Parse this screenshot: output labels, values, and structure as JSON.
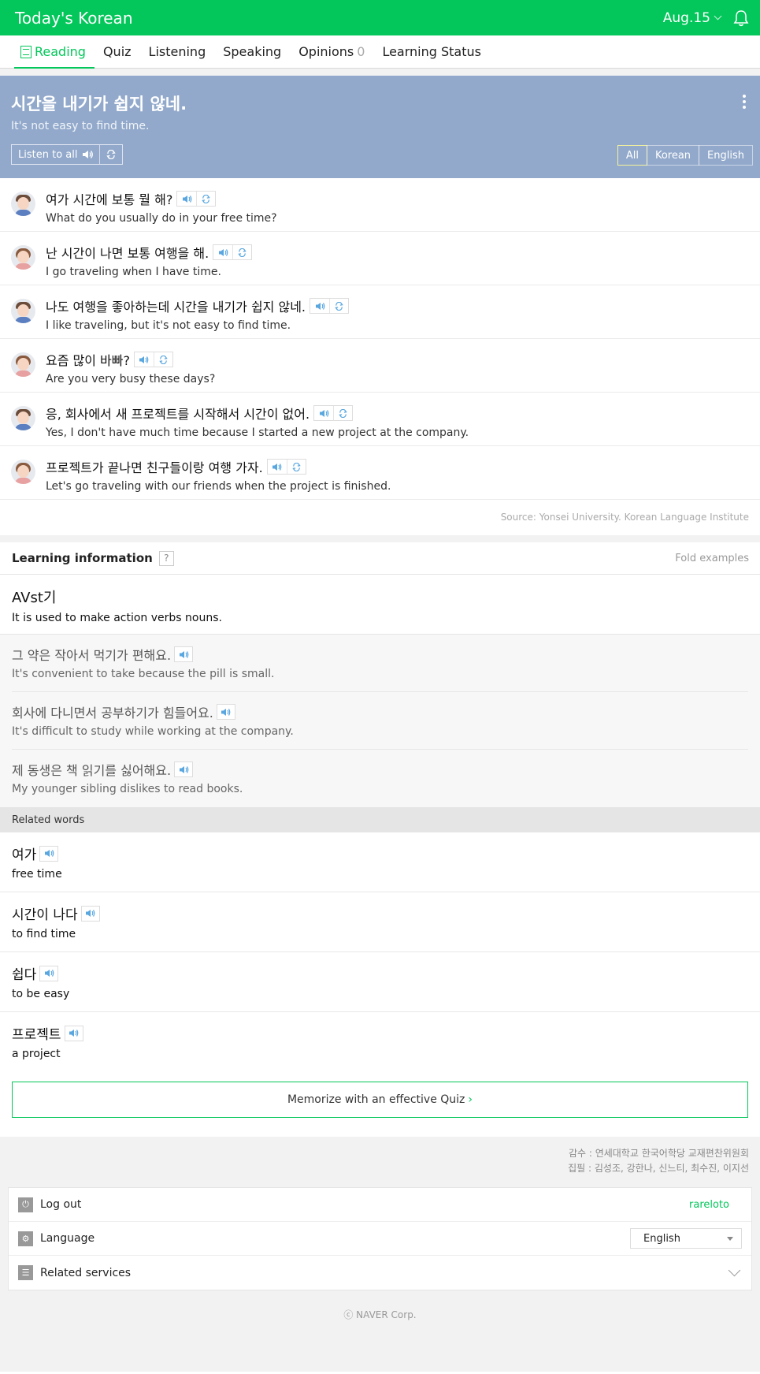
{
  "header": {
    "app_title": "Today's Korean",
    "date": "Aug.15"
  },
  "tabs": [
    {
      "label": "Reading",
      "active": true
    },
    {
      "label": "Quiz"
    },
    {
      "label": "Listening"
    },
    {
      "label": "Speaking"
    },
    {
      "label": "Opinions",
      "count": "0"
    },
    {
      "label": "Learning Status"
    }
  ],
  "lesson": {
    "title_ko": "시간을 내기가 쉽지 않네.",
    "title_en": "It's not easy to find time.",
    "listen_all": "Listen to all",
    "filters": [
      "All",
      "Korean",
      "English"
    ],
    "active_filter": "All"
  },
  "dialogue": [
    {
      "speaker": "male",
      "ko": "여가 시간에 보통 뭘 해?",
      "en": "What do you usually do in your free time?"
    },
    {
      "speaker": "female",
      "ko": "난 시간이 나면 보통 여행을 해.",
      "en": "I go traveling when I have time."
    },
    {
      "speaker": "male",
      "ko": "나도 여행을 좋아하는데 시간을 내기가 쉽지 않네.",
      "en": "I like traveling, but it's not easy to find time."
    },
    {
      "speaker": "female",
      "ko": "요즘 많이 바빠?",
      "en": "Are you very busy these days?"
    },
    {
      "speaker": "male",
      "ko": "응, 회사에서 새 프로젝트를 시작해서 시간이 없어.",
      "en": "Yes, I don't have much time because I started a new project at the company."
    },
    {
      "speaker": "female",
      "ko": "프로젝트가 끝나면 친구들이랑 여행 가자.",
      "en": "Let's go traveling with our friends when the project is finished."
    }
  ],
  "source": "Source: Yonsei University. Korean Language Institute",
  "learning": {
    "heading": "Learning information",
    "help": "?",
    "fold": "Fold examples",
    "pattern": "AVst기",
    "description": "It is used to make action verbs nouns.",
    "examples": [
      {
        "ko": "그 약은 작아서 먹기가 편해요.",
        "en": "It's convenient to take because the pill is small."
      },
      {
        "ko": "회사에 다니면서 공부하기가 힘들어요.",
        "en": "It's difficult to study while working at the company."
      },
      {
        "ko": "제 동생은 책 읽기를 싫어해요.",
        "en": "My younger sibling dislikes to read books."
      }
    ]
  },
  "related": {
    "heading": "Related words",
    "words": [
      {
        "ko": "여가",
        "en": "free time"
      },
      {
        "ko": "시간이 나다",
        "en": "to find time"
      },
      {
        "ko": "쉽다",
        "en": "to be easy"
      },
      {
        "ko": "프로젝트",
        "en": "a project"
      }
    ]
  },
  "quiz_button": "Memorize with an effective Quiz",
  "credits": {
    "line1": "감수 : 연세대학교 한국어학당 교재편찬위원회",
    "line2": "집필 : 김성조, 강한나, 신느티, 최수진, 이지선"
  },
  "menu": {
    "logout": "Log out",
    "username": "rareloto",
    "language_label": "Language",
    "language_value": "English",
    "related_services": "Related services"
  },
  "copyright": "ⓒ NAVER Corp.",
  "colors": {
    "brand": "#03c75a",
    "banner": "#92a9cb",
    "sound": "#5aa7e0"
  }
}
